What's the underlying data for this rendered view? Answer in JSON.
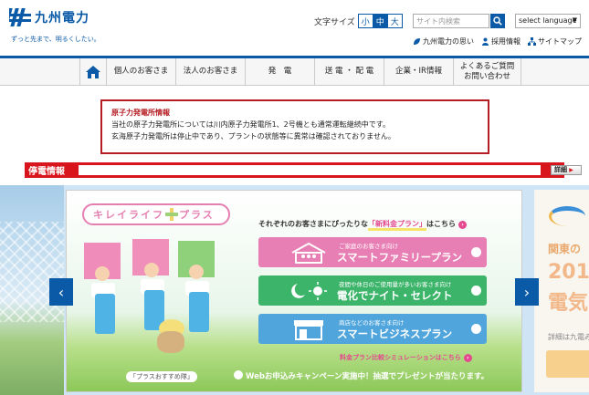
{
  "header": {
    "logo_text": "九州電力",
    "tagline": "ずっと先まで、明るくしたい。",
    "font_size_label": "文字サイズ",
    "font_sizes": [
      "小",
      "中",
      "大"
    ],
    "active_font_size": "中",
    "search_placeholder": "サイト内検索",
    "language_select": "select language",
    "top_links": [
      "九州電力の思い",
      "採用情報",
      "サイトマップ"
    ]
  },
  "nav": {
    "items": [
      "個人のお客さま",
      "法人のお客さま",
      "発　電",
      "送 電 ・ 配 電",
      "企業・IR情報",
      "よくあるご質問\nお問い合わせ"
    ]
  },
  "notice": {
    "title": "原子力発電所情報",
    "line1": "当社の原子力発電所については川内原子力発電所1、2号機とも通常運転継続中です。",
    "line2": "玄海原子力発電所は停止中であり、プラントの状態等に異常は確認されておりません。"
  },
  "outage": {
    "label": "停電情報",
    "detail_button": "詳細"
  },
  "carousel": {
    "slide_title_1": "キレイライフ",
    "slide_title_2": "プラス",
    "kids_caption": "「プラスおすすめ隊」",
    "plans_head_pre": "それぞれのお客さまにぴったりな",
    "plans_head_highlight": "「新料金プラン」",
    "plans_head_post": "はこちら",
    "plans": [
      {
        "sub": "ご家庭のお客さま向け",
        "name": "スマートファミリープラン"
      },
      {
        "sub": "夜間や休日のご使用量が多いお客さま向け",
        "name": "電化でナイト・セレクト"
      },
      {
        "sub": "商店などのお客さま向け",
        "name": "スマートビジネスプラン"
      }
    ],
    "simulation": "料金プラン比較シミュレーションはこちら",
    "campaign": "Webお申込みキャンペーン実施中！抽選でプレゼントが当たります。",
    "next_slide": {
      "line1": "関東の",
      "line2": "201",
      "line3": "電気",
      "line4": "詳細は九電み"
    }
  },
  "colors": {
    "brand_blue": "#0a5aa8",
    "alert_red": "#d8151c",
    "notice_border": "#b51d22",
    "plan_family": "#e87fb4",
    "plan_night": "#3cb46a",
    "plan_business": "#4fa5dc"
  }
}
